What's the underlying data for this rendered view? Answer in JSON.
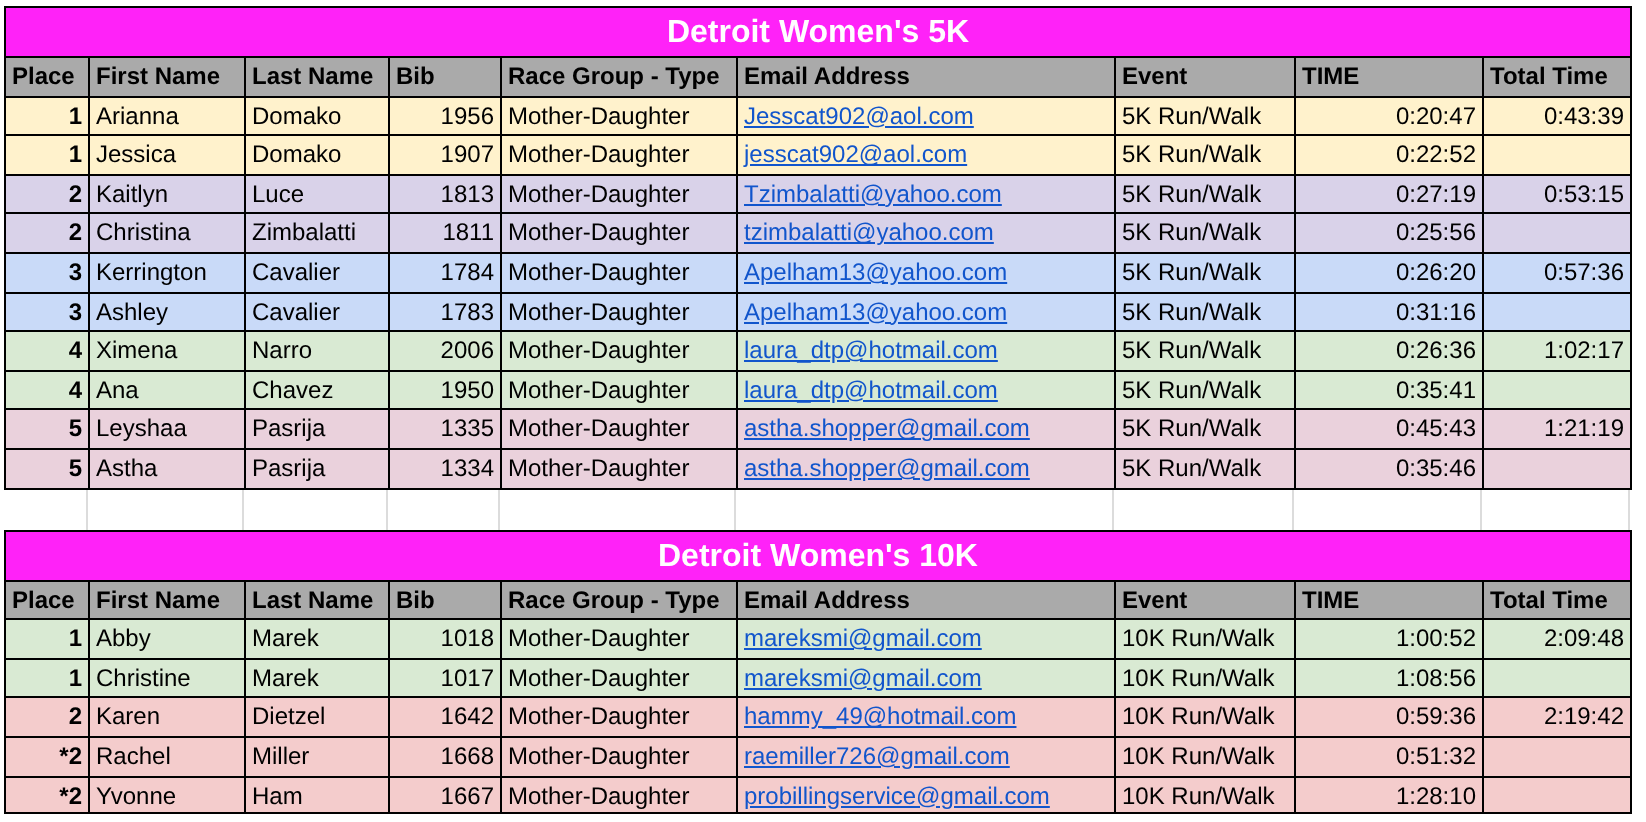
{
  "sections": [
    {
      "title": "Detroit Women's 5K",
      "columns": [
        {
          "label": "Place",
          "kind": "place"
        },
        {
          "label": "First Name",
          "kind": "text"
        },
        {
          "label": "Last Name",
          "kind": "text"
        },
        {
          "label": "Bib",
          "kind": "number"
        },
        {
          "label": "Race Group - Type",
          "kind": "text"
        },
        {
          "label": "Email Address",
          "kind": "email"
        },
        {
          "label": "Event",
          "kind": "text"
        },
        {
          "label": "TIME",
          "kind": "number"
        },
        {
          "label": "Total Time",
          "kind": "number"
        }
      ],
      "rows": [
        {
          "color": "#fff2cc",
          "cells": [
            "1",
            "Arianna",
            "Domako",
            "1956",
            "Mother-Daughter",
            "Jesscat902@aol.com",
            "5K Run/Walk",
            "0:20:47",
            "0:43:39"
          ]
        },
        {
          "color": "#fff2cc",
          "cells": [
            "1",
            "Jessica",
            "Domako",
            "1907",
            "Mother-Daughter",
            "jesscat902@aol.com",
            "5K Run/Walk",
            "0:22:52"
          ]
        },
        {
          "color": "#d9d2e9",
          "cells": [
            "2",
            "Kaitlyn",
            "Luce",
            "1813",
            "Mother-Daughter",
            "Tzimbalatti@yahoo.com",
            "5K Run/Walk",
            "0:27:19",
            "0:53:15"
          ]
        },
        {
          "color": "#d9d2e9",
          "cells": [
            "2",
            "Christina",
            "Zimbalatti",
            "1811",
            "Mother-Daughter",
            "tzimbalatti@yahoo.com",
            "5K Run/Walk",
            "0:25:56"
          ]
        },
        {
          "color": "#c9daf8",
          "cells": [
            "3",
            "Kerrington",
            "Cavalier",
            "1784",
            "Mother-Daughter",
            "Apelham13@yahoo.com",
            "5K Run/Walk",
            "0:26:20",
            "0:57:36"
          ]
        },
        {
          "color": "#c9daf8",
          "cells": [
            "3",
            "Ashley",
            "Cavalier",
            "1783",
            "Mother-Daughter",
            "Apelham13@yahoo.com",
            "5K Run/Walk",
            "0:31:16"
          ]
        },
        {
          "color": "#d9ead3",
          "cells": [
            "4",
            "Ximena",
            "Narro",
            "2006",
            "Mother-Daughter",
            "laura_dtp@hotmail.com",
            "5K Run/Walk",
            "0:26:36",
            "1:02:17"
          ]
        },
        {
          "color": "#d9ead3",
          "cells": [
            "4",
            "Ana",
            "Chavez",
            "1950",
            "Mother-Daughter",
            "laura_dtp@hotmail.com",
            "5K Run/Walk",
            "0:35:41"
          ]
        },
        {
          "color": "#ead1dc",
          "cells": [
            "5",
            "Leyshaa",
            "Pasrija",
            "1335",
            "Mother-Daughter",
            "astha.shopper@gmail.com",
            "5K Run/Walk",
            "0:45:43",
            "1:21:19"
          ]
        },
        {
          "color": "#ead1dc",
          "cells": [
            "5",
            "Astha",
            "Pasrija",
            "1334",
            "Mother-Daughter",
            "astha.shopper@gmail.com",
            "5K Run/Walk",
            "0:35:46"
          ]
        }
      ]
    },
    {
      "title": "Detroit Women's 10K",
      "columns": [
        {
          "label": "Place",
          "kind": "place"
        },
        {
          "label": "First Name",
          "kind": "text"
        },
        {
          "label": "Last Name",
          "kind": "text"
        },
        {
          "label": "Bib",
          "kind": "number"
        },
        {
          "label": "Race Group - Type",
          "kind": "text"
        },
        {
          "label": "Email Address",
          "kind": "email"
        },
        {
          "label": "Event",
          "kind": "text"
        },
        {
          "label": "TIME",
          "kind": "number"
        },
        {
          "label": "Total Time",
          "kind": "number"
        }
      ],
      "rows": [
        {
          "color": "#d9ead3",
          "cells": [
            "1",
            "Abby",
            "Marek",
            "1018",
            "Mother-Daughter",
            "mareksmi@gmail.com",
            "10K Run/Walk",
            "1:00:52",
            "2:09:48"
          ]
        },
        {
          "color": "#d9ead3",
          "cells": [
            "1",
            "Christine",
            "Marek",
            "1017",
            "Mother-Daughter",
            "mareksmi@gmail.com",
            "10K Run/Walk",
            "1:08:56"
          ]
        },
        {
          "color": "#f4cccc",
          "cells": [
            "2",
            "Karen",
            "Dietzel",
            "1642",
            "Mother-Daughter",
            "hammy_49@hotmail.com",
            "10K Run/Walk",
            "0:59:36",
            "2:19:42"
          ]
        },
        {
          "color": "#f4cccc",
          "cells": [
            "*2",
            "Rachel",
            "Miller",
            "1668",
            "Mother-Daughter",
            "raemiller726@gmail.com",
            "10K Run/Walk",
            "0:51:32"
          ]
        },
        {
          "color": "#f4cccc",
          "cells": [
            "*2",
            "Yvonne",
            "Ham",
            "1667",
            "Mother-Daughter",
            "probillingservice@gmail.com",
            "10K Run/Walk",
            "1:28:10"
          ]
        }
      ]
    }
  ]
}
